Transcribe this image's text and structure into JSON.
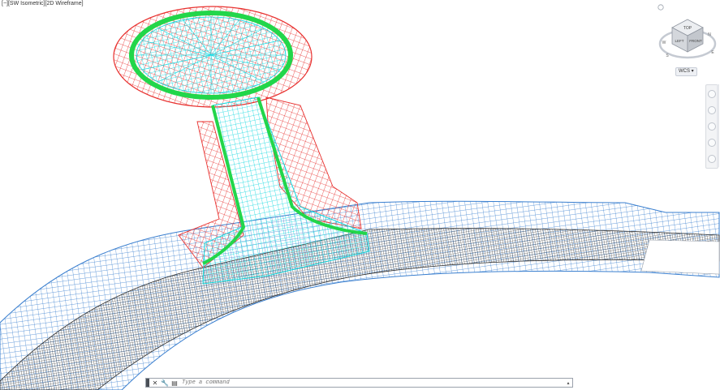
{
  "viewport": {
    "view_label_parts": [
      "[−]",
      "[SW Isometric]",
      "[2D Wireframe]"
    ]
  },
  "viewcube": {
    "faces": {
      "top": "TOP",
      "left": "LEFT",
      "front": "FRONT"
    },
    "compass_letters": [
      "N",
      "W",
      "S",
      "E"
    ],
    "wcs_label": "WCS"
  },
  "command_line": {
    "placeholder": "Type a command"
  },
  "colors": {
    "red": "#e8302e",
    "green": "#22d64a",
    "cyan": "#12d8e0",
    "blue": "#3a7fcf",
    "dark": "#2b2b2b"
  }
}
